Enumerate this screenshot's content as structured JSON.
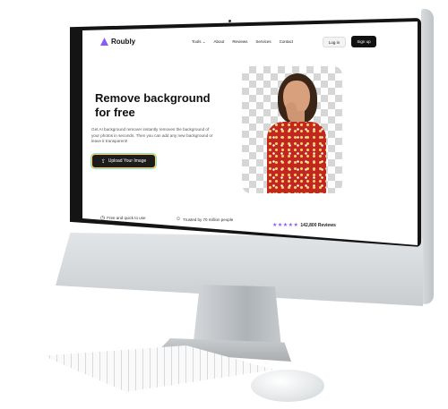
{
  "nav": {
    "logo": "Roubly",
    "links": [
      "Tools",
      "About",
      "Reviews",
      "Services",
      "Contact"
    ],
    "login": "Log in",
    "signup": "Sign up"
  },
  "hero": {
    "title_line1": "Remove background",
    "title_line2": "for free",
    "description": "Get AI background remover instantly removes the background of your photos in seconds. Then you can add any new background or leave it transparent!",
    "upload_button": "Upload Your Image"
  },
  "features": {
    "item1": "Free and quick to use",
    "item2": "Trusted by 70 million people",
    "stars": "★★★★★",
    "reviews": "142,800 Reviews"
  },
  "colors": {
    "accent": "#8a5cf6",
    "dark": "#111111"
  }
}
